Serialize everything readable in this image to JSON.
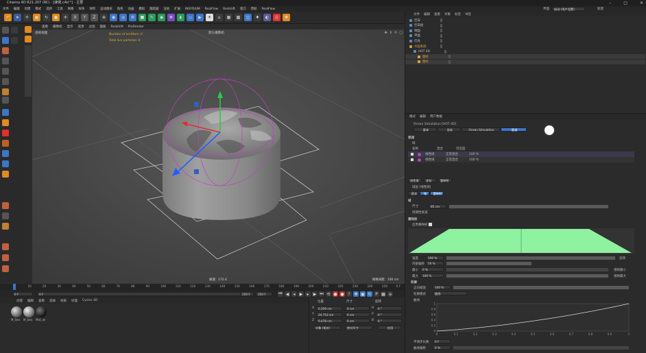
{
  "title": "Cinema 4D R21.207 (RC) - [蜂窝.c4d *] - 主要",
  "menu": [
    "文件",
    "编辑",
    "创建",
    "模式",
    "选择",
    "工具",
    "网格",
    "样条",
    "体积",
    "运动图形",
    "角色",
    "动画",
    "模拟",
    "跟踪器",
    "渲染",
    "扩展",
    "INSYDIUM",
    "RealFlow",
    "Redshift",
    "窗口",
    "帮助",
    "RealFlow"
  ],
  "layout_label": "界面",
  "layout_value": "启动 (用户设置)",
  "new_label": "新建",
  "viewport": {
    "menu": [
      "查看",
      "摄像机",
      "显示",
      "选项",
      "过滤",
      "面板",
      "Redshift",
      "ProRender"
    ],
    "name": "透视视图",
    "camera": "默认摄像机",
    "hud_line1": "Number of emitters: 0",
    "hud_line2": "Total live particles: 0",
    "fps": "帧速：172.4",
    "grid": "网格间距：100 cm"
  },
  "timeline": {
    "ticks": [
      "0",
      "10",
      "20",
      "30",
      "40",
      "50",
      "60",
      "70",
      "80",
      "90",
      "100",
      "110",
      "120",
      "130",
      "140",
      "150",
      "160",
      "170",
      "180",
      "190",
      "200",
      "210",
      "220",
      "230",
      "240",
      "250"
    ],
    "end_frame": "0 F",
    "start_field": "0 F",
    "cur_field": "0 F",
    "max_field": "250 F",
    "max_field2": "250 F"
  },
  "materials": {
    "menu": [
      "创建",
      "编辑",
      "查看",
      "选择",
      "材质",
      "纹理",
      "Cycles 4D"
    ],
    "items": [
      "M_Sea",
      "M_Sea",
      "Mat_an"
    ]
  },
  "coords": {
    "headers": [
      "位置",
      "尺寸",
      "旋转"
    ],
    "rows": [
      {
        "axis": "X",
        "pos": "0.256 cm",
        "size": "0 cm",
        "rot_label": "H",
        "rot": "0 °"
      },
      {
        "axis": "Y",
        "pos": "24.753 cm",
        "size": "0 cm",
        "rot_label": "P",
        "rot": "0 °"
      },
      {
        "axis": "Z",
        "pos": "0.478 cm",
        "size": "0 cm",
        "rot_label": "B",
        "rot": "0 °"
      }
    ],
    "mode1": "对象 (相对)",
    "mode2": "绝对尺寸",
    "apply": "应用"
  },
  "objmgr": {
    "menu": [
      "文件",
      "编辑",
      "查看",
      "对象",
      "标签",
      "书签"
    ],
    "items": [
      {
        "name": "空白",
        "color": "#c8c8c8",
        "indent": 0
      },
      {
        "name": "空白组",
        "color": "#c8c8c8",
        "indent": 0
      },
      {
        "name": "地面",
        "color": "#c8c8c8",
        "indent": 0
      },
      {
        "name": "平面",
        "color": "#c8c8c8",
        "indent": 0
      },
      {
        "name": "灯光",
        "color": "#c8c8c8",
        "indent": 0
      },
      {
        "name": "水面系统",
        "color": "#d0a040",
        "indent": 0
      },
      {
        "name": "HOT 4D",
        "color": "#c8c8c8",
        "indent": 1
      },
      {
        "name": "圆柱",
        "color": "#e0a040",
        "indent": 2
      },
      {
        "name": "圆柱",
        "color": "#e0a040",
        "indent": 2
      }
    ]
  },
  "attr": {
    "menu": [
      "模式",
      "编辑",
      "用户数据"
    ],
    "object_title": "Ocean Simulation [HOT 4D]",
    "tabs": [
      "基本",
      "坐标",
      "Ocean Simulation",
      "衰减"
    ],
    "section": "衰减",
    "domain": "域",
    "table_headers": [
      "名称",
      "混合",
      "可见度"
    ],
    "table_rows": [
      {
        "name": "线性域",
        "blend": "正常混合",
        "vis": "100 %"
      },
      {
        "name": "线性域",
        "blend": "正常混合",
        "vis": "100 %"
      }
    ],
    "sub_tabs": [
      "线性域",
      "坐标",
      "重映射"
    ],
    "sub_title": "域层 [线性域]",
    "sub_tabs2": [
      "基本",
      "域",
      "重映射"
    ],
    "field_section": "域",
    "size_label": "尺寸",
    "size_value": "85 cm",
    "only_contents": "周期性衰减",
    "remap_section": "重映射",
    "enable_remap": "启用重映射",
    "strength_label": "强度",
    "strength": "100 %",
    "invert": "反转",
    "contour_label": "内部偏移",
    "contour": "50 %",
    "min_label": "最小",
    "min": "0 %",
    "max_label": "最大",
    "max": "100 %",
    "clamp_min": "限制最小",
    "clamp_max": "限制最大",
    "contour_section": "轮廓",
    "pos_label": "正向缩放",
    "pos_value": "100 %",
    "contour_mode_label": "轮廓模式",
    "contour_mode": "曲线",
    "curve_label": "曲线",
    "curve_y": [
      "1",
      "0.8",
      "0.6",
      "0.4",
      "0.2",
      "0"
    ],
    "curve_x": [
      "0",
      "0.1",
      "0.2",
      "0.3",
      "0.4",
      "0.5",
      "0.6",
      "0.7",
      "0.8",
      "0.9",
      "1"
    ],
    "steps_label": "平滑步长数",
    "steps": "0 F",
    "offset_label": "曲线偏移",
    "offset": "0 %"
  },
  "colors": {
    "accent": "#3c76c8",
    "falloff_green": "#8ef2a0",
    "selection": "#c040c0",
    "axis_y": "#2ecc40",
    "axis_x": "#e03030",
    "axis_z": "#2060ff"
  }
}
